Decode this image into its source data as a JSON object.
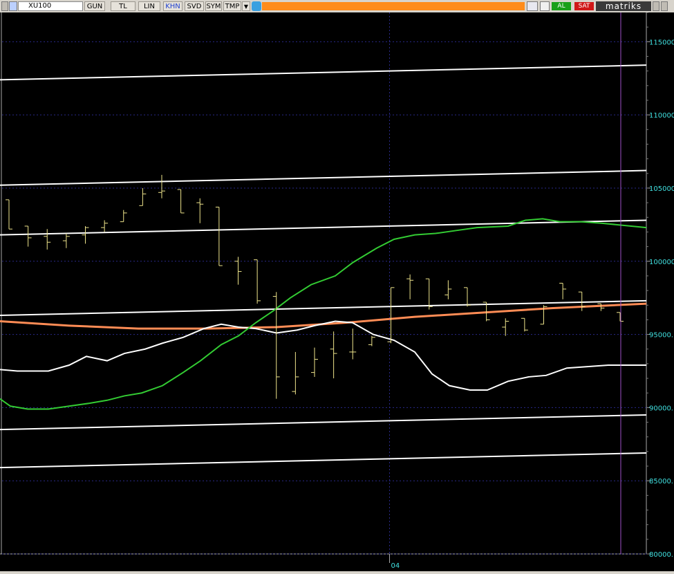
{
  "toolbar": {
    "symbol": "XU100",
    "buttons": [
      {
        "label": "GUN"
      },
      {
        "label": "TL"
      },
      {
        "label": "LIN"
      },
      {
        "label": "KHN"
      },
      {
        "label": "SVD"
      },
      {
        "label": "SYM"
      },
      {
        "label": "TMP"
      }
    ],
    "active_button": "KHN",
    "buy_label": "AL",
    "sell_label": "SAT",
    "brand": "matriks",
    "accent_color": "#ff8c1a",
    "buy_color": "#19a019",
    "sell_color": "#d01818"
  },
  "chart_data": {
    "type": "ohlc",
    "ylim": [
      80000,
      117000
    ],
    "yticks": [
      80000,
      85000,
      90000,
      95000,
      100000,
      105000,
      110000,
      115000
    ],
    "ytick_labels": [
      "80000.",
      "85000.",
      "90000.",
      "95000.",
      "100000",
      "105000",
      "110000",
      "115000"
    ],
    "x_label_text": "04",
    "x_label_index": 20,
    "bar_color": "#f0e68c",
    "background": "#000000",
    "bars": [
      {
        "o": 104200,
        "h": 104200,
        "l": 102200,
        "c": 102200
      },
      {
        "o": 102400,
        "h": 102400,
        "l": 101000,
        "c": 101600
      },
      {
        "o": 101700,
        "h": 102200,
        "l": 100800,
        "c": 101300
      },
      {
        "o": 101400,
        "h": 101900,
        "l": 100900,
        "c": 101700
      },
      {
        "o": 101800,
        "h": 102400,
        "l": 101200,
        "c": 102300
      },
      {
        "o": 102300,
        "h": 102800,
        "l": 102000,
        "c": 102600
      },
      {
        "o": 102700,
        "h": 103500,
        "l": 102700,
        "c": 103300
      },
      {
        "o": 103800,
        "h": 105000,
        "l": 103800,
        "c": 104600
      },
      {
        "o": 104700,
        "h": 105900,
        "l": 104300,
        "c": 104800
      },
      {
        "o": 104900,
        "h": 104900,
        "l": 103300,
        "c": 103300
      },
      {
        "o": 104000,
        "h": 104300,
        "l": 102600,
        "c": 103900
      },
      {
        "o": 103700,
        "h": 103700,
        "l": 99700,
        "c": 99700
      },
      {
        "o": 100000,
        "h": 100300,
        "l": 98400,
        "c": 99300
      },
      {
        "o": 100100,
        "h": 100100,
        "l": 97100,
        "c": 97300
      },
      {
        "o": 97600,
        "h": 97900,
        "l": 90600,
        "c": 92100
      },
      {
        "o": 91100,
        "h": 93800,
        "l": 90900,
        "c": 92100
      },
      {
        "o": 92400,
        "h": 94100,
        "l": 92100,
        "c": 93300
      },
      {
        "o": 94000,
        "h": 95200,
        "l": 92000,
        "c": 93700
      },
      {
        "o": 93800,
        "h": 95400,
        "l": 93300,
        "c": 93800
      },
      {
        "o": 94300,
        "h": 94900,
        "l": 94200,
        "c": 94800
      },
      {
        "o": 94500,
        "h": 98200,
        "l": 94400,
        "c": 98200
      },
      {
        "o": 98800,
        "h": 99100,
        "l": 97400,
        "c": 98700
      },
      {
        "o": 98800,
        "h": 98800,
        "l": 96700,
        "c": 96900
      },
      {
        "o": 97700,
        "h": 98700,
        "l": 97400,
        "c": 98100
      },
      {
        "o": 98200,
        "h": 98200,
        "l": 96900,
        "c": 97000
      },
      {
        "o": 97200,
        "h": 97200,
        "l": 95900,
        "c": 96000
      },
      {
        "o": 95500,
        "h": 96100,
        "l": 94900,
        "c": 95900
      },
      {
        "o": 96100,
        "h": 96100,
        "l": 95200,
        "c": 95300
      },
      {
        "o": 95700,
        "h": 97000,
        "l": 95700,
        "c": 96900
      },
      {
        "o": 98500,
        "h": 98500,
        "l": 97400,
        "c": 98100
      },
      {
        "o": 97900,
        "h": 97900,
        "l": 96600,
        "c": 96900
      },
      {
        "o": 97100,
        "h": 97100,
        "l": 96600,
        "c": 96800
      },
      {
        "o": 96500,
        "h": 96500,
        "l": 95900,
        "c": 95900
      }
    ],
    "lines": [
      {
        "name": "",
        "color": "#ffffff",
        "width": 2,
        "points": [
          [
            0,
            112400
          ],
          [
            935,
            113400
          ]
        ]
      },
      {
        "name": "",
        "color": "#ffffff",
        "width": 2,
        "points": [
          [
            0,
            105200
          ],
          [
            935,
            106200
          ]
        ]
      },
      {
        "name": "",
        "color": "#ffffff",
        "width": 2,
        "points": [
          [
            0,
            101800
          ],
          [
            935,
            102800
          ]
        ]
      },
      {
        "name": "",
        "color": "#ffffff",
        "width": 2,
        "points": [
          [
            0,
            96300
          ],
          [
            935,
            97300
          ]
        ]
      },
      {
        "name": "",
        "color": "#ffffff",
        "width": 2,
        "points": [
          [
            0,
            88500
          ],
          [
            935,
            89500
          ]
        ]
      },
      {
        "name": "",
        "color": "#ffffff",
        "width": 2,
        "points": [
          [
            0,
            85900
          ],
          [
            935,
            86900
          ]
        ]
      },
      {
        "name": "",
        "color": "#ff8c55",
        "width": 3,
        "points": [
          [
            0,
            95900
          ],
          [
            100,
            95600
          ],
          [
            200,
            95400
          ],
          [
            300,
            95400
          ],
          [
            400,
            95500
          ],
          [
            500,
            95800
          ],
          [
            600,
            96200
          ],
          [
            700,
            96500
          ],
          [
            800,
            96800
          ],
          [
            935,
            97100
          ]
        ]
      },
      {
        "name": "",
        "color": "#ffffff",
        "width": 2,
        "points": [
          [
            0,
            92600
          ],
          [
            25,
            92500
          ],
          [
            70,
            92500
          ],
          [
            100,
            92900
          ],
          [
            125,
            93500
          ],
          [
            155,
            93200
          ],
          [
            180,
            93700
          ],
          [
            210,
            94000
          ],
          [
            235,
            94400
          ],
          [
            265,
            94800
          ],
          [
            295,
            95400
          ],
          [
            320,
            95700
          ],
          [
            345,
            95500
          ],
          [
            370,
            95400
          ],
          [
            400,
            95100
          ],
          [
            430,
            95300
          ],
          [
            455,
            95600
          ],
          [
            485,
            95900
          ],
          [
            510,
            95800
          ],
          [
            540,
            95000
          ],
          [
            570,
            94600
          ],
          [
            600,
            93800
          ],
          [
            625,
            92300
          ],
          [
            650,
            91500
          ],
          [
            680,
            91200
          ],
          [
            705,
            91200
          ],
          [
            735,
            91800
          ],
          [
            765,
            92100
          ],
          [
            790,
            92200
          ],
          [
            820,
            92700
          ],
          [
            850,
            92800
          ],
          [
            880,
            92900
          ],
          [
            935,
            92900
          ]
        ]
      },
      {
        "name": "",
        "color": "#33cc33",
        "width": 2,
        "points": [
          [
            0,
            90600
          ],
          [
            15,
            90100
          ],
          [
            40,
            89900
          ],
          [
            70,
            89900
          ],
          [
            100,
            90100
          ],
          [
            130,
            90300
          ],
          [
            155,
            90500
          ],
          [
            180,
            90800
          ],
          [
            205,
            91000
          ],
          [
            235,
            91500
          ],
          [
            265,
            92400
          ],
          [
            290,
            93200
          ],
          [
            320,
            94300
          ],
          [
            345,
            94900
          ],
          [
            370,
            95800
          ],
          [
            395,
            96600
          ],
          [
            420,
            97500
          ],
          [
            450,
            98400
          ],
          [
            485,
            99000
          ],
          [
            510,
            99900
          ],
          [
            545,
            100900
          ],
          [
            570,
            101500
          ],
          [
            600,
            101800
          ],
          [
            630,
            101900
          ],
          [
            660,
            102100
          ],
          [
            690,
            102300
          ],
          [
            735,
            102400
          ],
          [
            760,
            102800
          ],
          [
            785,
            102900
          ],
          [
            810,
            102700
          ],
          [
            840,
            102700
          ],
          [
            870,
            102600
          ],
          [
            935,
            102300
          ]
        ]
      }
    ]
  }
}
